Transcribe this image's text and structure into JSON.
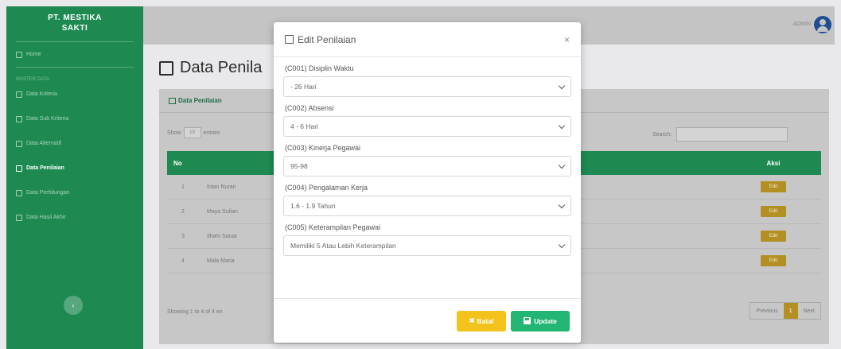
{
  "brand": {
    "line1": "PT. MESTIKA",
    "line2": "SAKTI"
  },
  "sidebar": {
    "heading": "MASTER DATA",
    "items": [
      {
        "label": "Home",
        "icon": "home-icon"
      },
      {
        "label": "Data Kriteria",
        "icon": "cube-icon"
      },
      {
        "label": "Data Sub Kriteria",
        "icon": "cubes-icon"
      },
      {
        "label": "Data Alternatif",
        "icon": "users-icon"
      },
      {
        "label": "Data Penilaian",
        "icon": "edit-icon"
      },
      {
        "label": "Data Perhitungan",
        "icon": "calculator-icon"
      },
      {
        "label": "Data Hasil Akhir",
        "icon": "chart-icon"
      }
    ],
    "toggle_symbol": "‹"
  },
  "topbar": {
    "user": "ADMIN"
  },
  "page": {
    "title": "Data Penila",
    "card_title": "Data Penilaian",
    "show_label": "Show",
    "entries_value": "10",
    "entries_label": "entries",
    "search_label": "Search:",
    "columns": {
      "no": "No",
      "aksi": "Aksi"
    },
    "rows": [
      {
        "no": "1",
        "name": "Intan Nuran"
      },
      {
        "no": "2",
        "name": "Maya Sufian"
      },
      {
        "no": "3",
        "name": "Ilham Saraa"
      },
      {
        "no": "4",
        "name": "Mala Maria"
      }
    ],
    "row_edit_label": "Edit",
    "footer_info": "Showing 1 to 4 of 4 en",
    "pager": {
      "prev": "Previous",
      "current": "1",
      "next": "Next"
    }
  },
  "modal": {
    "title": "Edit Penilaian",
    "close": "×",
    "fields": [
      {
        "label": "(C001) Disiplin Waktu",
        "value": "- 26 Hari"
      },
      {
        "label": "(C002) Absensi",
        "value": "4 - 6 Hari"
      },
      {
        "label": "(C003) Kinerja Pegawai",
        "value": "95-98"
      },
      {
        "label": "(C004) Pengalaman Kerja",
        "value": "1.6 - 1.9 Tahun"
      },
      {
        "label": "(C005) Keterampilan Pegawai",
        "value": "Memiliki 5 Atau Lebih Keterampilan"
      }
    ],
    "cancel_label": "Batal",
    "cancel_symbol": "✖",
    "update_label": "Update"
  }
}
